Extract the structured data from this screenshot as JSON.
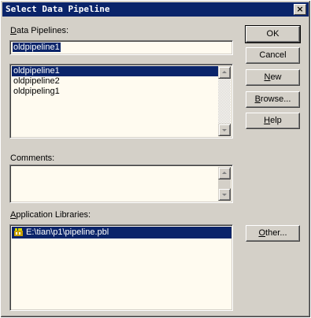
{
  "window": {
    "title": "Select Data Pipeline",
    "close_label": "×"
  },
  "data_pipelines": {
    "label_accel": "D",
    "label_rest": "ata Pipelines:",
    "input_value": "oldpipeline1",
    "items": [
      {
        "label": "oldpipeline1",
        "selected": true
      },
      {
        "label": "oldpipeline2",
        "selected": false
      },
      {
        "label": "oldpipeling1",
        "selected": false
      }
    ]
  },
  "comments": {
    "label": "Comments:",
    "value": ""
  },
  "application_libraries": {
    "label_accel": "A",
    "label_rest": "pplication Libraries:",
    "items": [
      {
        "label": "E:\\tian\\p1\\pipeline.pbl",
        "icon": "library-icon",
        "selected": true
      }
    ]
  },
  "buttons": {
    "ok": "OK",
    "cancel": "Cancel",
    "new_accel": "N",
    "new_rest": "ew",
    "browse_accel": "B",
    "browse_rest": "rowse...",
    "help_accel": "H",
    "help_rest": "elp",
    "other_accel": "O",
    "other_rest": "ther..."
  },
  "colors": {
    "face": "#d4d0c8",
    "titlebar": "#0a246a",
    "field_bg": "#fffbf0",
    "selection": "#0a246a"
  }
}
